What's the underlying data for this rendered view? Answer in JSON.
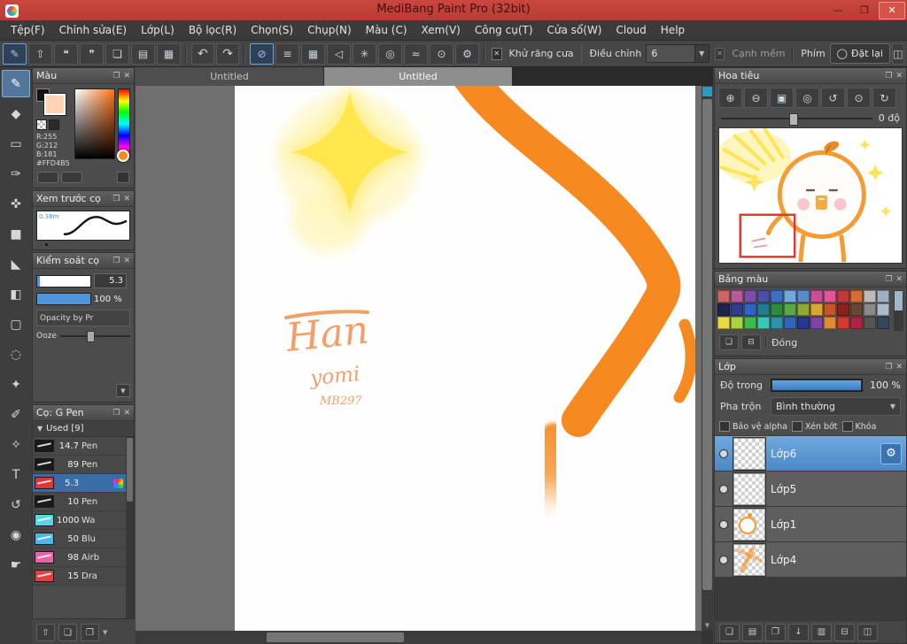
{
  "window": {
    "title": "MediBang Paint Pro (32bit)",
    "minimize_glyph": "—",
    "maximize_glyph": "❐",
    "close_glyph": "✕"
  },
  "menu": {
    "items": [
      "Tệp(F)",
      "Chỉnh sửa(E)",
      "Lớp(L)",
      "Bộ lọc(R)",
      "Chọn(S)",
      "Chụp(N)",
      "Màu (C)",
      "Xem(V)",
      "Công cụ(T)",
      "Cửa sổ(W)",
      "Cloud",
      "Help"
    ]
  },
  "toolbar": {
    "file_buttons": [
      {
        "name": "brush-settings-icon",
        "glyph": "✎",
        "selected": true
      },
      {
        "name": "export-icon",
        "glyph": "⇧"
      },
      {
        "name": "comment-icon",
        "glyph": "❝"
      },
      {
        "name": "publish-icon",
        "glyph": "❞"
      },
      {
        "name": "new-canvas-icon",
        "glyph": "❏"
      },
      {
        "name": "canvas-list-icon",
        "glyph": "▤"
      },
      {
        "name": "material-grid-icon",
        "glyph": "▦"
      }
    ],
    "undo_glyph": "↶",
    "redo_glyph": "↷",
    "snap_buttons": [
      {
        "name": "snap-off-icon",
        "glyph": "⊘",
        "selected": true
      },
      {
        "name": "snap-parallel-icon",
        "glyph": "≡"
      },
      {
        "name": "snap-grid-icon",
        "glyph": "▦"
      },
      {
        "name": "snap-vanishing-icon",
        "glyph": "◁"
      },
      {
        "name": "snap-radial-icon",
        "glyph": "✳"
      },
      {
        "name": "snap-ellipse-icon",
        "glyph": "◎"
      },
      {
        "name": "snap-curve-icon",
        "glyph": "≈"
      },
      {
        "name": "snap-guide-icon",
        "glyph": "⊙"
      },
      {
        "name": "snap-settings-icon",
        "glyph": "⚙"
      }
    ],
    "check_glyph": "✕",
    "antialias_label": "Khử răng cưa",
    "adjust_label": "Điều chỉnh",
    "adjust_value": "6",
    "soft_edge_label": "Cạnh mềm",
    "key_label": "Phím",
    "reset_icon_glyph": "◯",
    "reset_label": "Đặt lại",
    "dock_glyph": "◫"
  },
  "tools": {
    "items": [
      {
        "name": "brush-tool",
        "glyph": "✎",
        "selected": true
      },
      {
        "name": "eraser-tool",
        "glyph": "◆"
      },
      {
        "name": "dot-pen-tool",
        "glyph": "▭"
      },
      {
        "name": "finger-tool",
        "glyph": "✑"
      },
      {
        "name": "move-tool",
        "glyph": "✜"
      },
      {
        "name": "fill-rect-tool",
        "glyph": "■"
      },
      {
        "name": "bucket-tool",
        "glyph": "◣"
      },
      {
        "name": "gradient-tool",
        "glyph": "◧"
      },
      {
        "name": "select-tool",
        "glyph": "▢"
      },
      {
        "name": "lasso-tool",
        "glyph": "◌"
      },
      {
        "name": "magic-wand-tool",
        "glyph": "✦"
      },
      {
        "name": "select-pen-tool",
        "glyph": "✐"
      },
      {
        "name": "select-eraser-tool",
        "glyph": "✧"
      },
      {
        "name": "text-tool",
        "glyph": "T"
      },
      {
        "name": "rotate-canvas-tool",
        "glyph": "↺"
      },
      {
        "name": "eyedropper-tool",
        "glyph": "◉"
      },
      {
        "name": "hand-tool",
        "glyph": "☛"
      }
    ]
  },
  "panels": {
    "color": {
      "title": "Màu",
      "r": "R:255",
      "g": "G:212",
      "b": "B:181",
      "hex": "#FFD4B5",
      "current": "#FFD4B5"
    },
    "brush_preview": {
      "title": "Xem trước cọ",
      "size": "0.38m"
    },
    "brush_control": {
      "title": "Kiểm soát cọ",
      "size_value": "5.3",
      "opacity_value": "100 %",
      "opt1": "Opacity by Pr",
      "opt2": "Ooze"
    },
    "brush_list": {
      "title": "Cọ: G Pen",
      "used": "Used [9]",
      "items": [
        {
          "size": "14.7",
          "name": "Pen",
          "swatch": "#1a1a1a"
        },
        {
          "size": "89",
          "name": "Pen",
          "swatch": "#1a1a1a"
        },
        {
          "size": "5.3",
          "name": "",
          "swatch": "#E03535",
          "selected": true
        },
        {
          "size": "10",
          "name": "Pen",
          "swatch": "#1a1a1a"
        },
        {
          "size": "1000",
          "name": "Wa",
          "swatch": "#57D6E8"
        },
        {
          "size": "50",
          "name": "Blu",
          "swatch": "#49B8F0"
        },
        {
          "size": "98",
          "name": "Airb",
          "swatch": "#EE5FA8"
        },
        {
          "size": "15",
          "name": "Dra",
          "swatch": "#E04040"
        }
      ]
    },
    "navigator": {
      "title": "Hoa tiêu",
      "angle": "0 độ",
      "buttons": [
        {
          "name": "zoom-in-icon",
          "glyph": "⊕"
        },
        {
          "name": "zoom-out-icon",
          "glyph": "⊖"
        },
        {
          "name": "zoom-fit-icon",
          "glyph": "▣"
        },
        {
          "name": "zoom-actual-icon",
          "glyph": "◎"
        },
        {
          "name": "rotate-left-icon",
          "glyph": "↺"
        },
        {
          "name": "reset-rotation-icon",
          "glyph": "⊙"
        },
        {
          "name": "rotate-right-icon",
          "glyph": "↻"
        }
      ]
    },
    "palette": {
      "title": "Bảng màu",
      "close_label": "Đóng",
      "buttons": [
        {
          "name": "add-color-icon",
          "glyph": "❏"
        },
        {
          "name": "delete-color-icon",
          "glyph": "⊟"
        }
      ],
      "swatches": [
        "#CC6666",
        "#B5599A",
        "#7B4FA6",
        "#4A4FA0",
        "#3F6FC0",
        "#6FA8DC",
        "#5A8ACB",
        "#C94F93",
        "#E2559B",
        "#C03A3A",
        "#D96A35",
        "#BBBBBB",
        "#9FB0C0",
        "#20224E",
        "#2C3E8C",
        "#2F63C4",
        "#1E7E8E",
        "#2E8B3A",
        "#55AA44",
        "#8FAA2E",
        "#D9A62E",
        "#C8542A",
        "#8C2020",
        "#6A4733",
        "#8A8A8A",
        "#ABBCCB",
        "#E8D93F",
        "#A8D43F",
        "#3FBB4A",
        "#37C9B5",
        "#2E93A8",
        "#2E66B8",
        "#27378C",
        "#7C46A8",
        "#E08A33",
        "#D43A2C",
        "#B02446",
        "#555555",
        "#36475A"
      ]
    },
    "layers": {
      "title": "Lớp",
      "opacity_label": "Độ trong",
      "opacity_value": "100 %",
      "blend_label": "Pha trộn",
      "blend_value": "Bình thường",
      "checks": [
        "Bảo vệ alpha",
        "Xén bớt",
        "Khóa"
      ],
      "gear_glyph": "⚙",
      "items": [
        {
          "label": "Lớp6",
          "selected": true,
          "variant": "empty"
        },
        {
          "label": "Lớp5",
          "variant": "empty"
        },
        {
          "label": "Lớp1",
          "variant": "character"
        },
        {
          "label": "Lớp4",
          "variant": "sketch"
        }
      ],
      "bottom_buttons": [
        {
          "name": "add-layer-icon",
          "glyph": "❏"
        },
        {
          "name": "add-folder-icon",
          "glyph": "▤"
        },
        {
          "name": "duplicate-layer-icon",
          "glyph": "❐"
        },
        {
          "name": "transfer-layer-icon",
          "glyph": "↓"
        },
        {
          "name": "folder-icon",
          "glyph": "▥"
        },
        {
          "name": "merge-layer-icon",
          "glyph": "⊟"
        },
        {
          "name": "layer-options-icon",
          "glyph": "◫"
        }
      ]
    }
  },
  "leftcol_bottom": {
    "buttons": [
      {
        "name": "scroll-top-icon",
        "glyph": "⇧"
      },
      {
        "name": "new-brush-icon",
        "glyph": "❏"
      },
      {
        "name": "brush-menu-icon",
        "glyph": "❐"
      }
    ]
  },
  "canvas": {
    "tabs": [
      {
        "label": "Untitled",
        "active": false
      },
      {
        "label": "Untitled",
        "active": true
      }
    ],
    "signature": {
      "line1": "Han",
      "line2": "yomi",
      "line3": "MB297"
    }
  },
  "accent_colors": {
    "orange": "#F6891F",
    "star_yellow": "#FFE74D",
    "selection_blue": "#5B9BD5",
    "titlebar_red": "#C0413A"
  }
}
